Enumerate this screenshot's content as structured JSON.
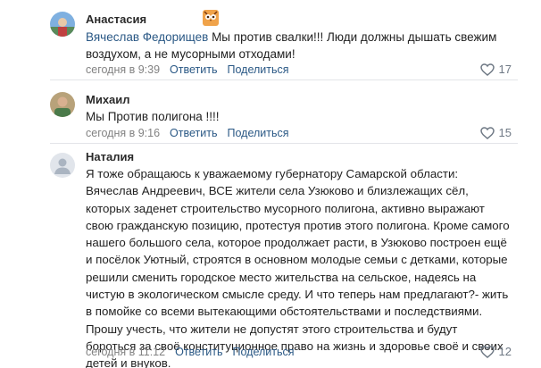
{
  "comments": [
    {
      "author": "Анастасия",
      "mention": "Вячеслав Федорищев",
      "text": " Мы против свалки!!! Люди должны дышать свежим воздухом, а не мусорными отходами!",
      "time": "сегодня в 9:39",
      "reply_label": "Ответить",
      "share_label": "Поделиться",
      "likes": "17",
      "avatar_icon": "user-photo"
    },
    {
      "author": "Михаил",
      "mention": "",
      "text": "Мы Против полигона !!!!",
      "time": "сегодня в 9:16",
      "reply_label": "Ответить",
      "share_label": "Поделиться",
      "likes": "15",
      "avatar_icon": "user-photo"
    },
    {
      "author": "Наталия",
      "mention": "",
      "text": "Я тоже обращаюсь к уважаемому губернатору Самарской области: Вячеслав Андреевич, ВСЕ жители села Узюково и близлежащих сёл, которых заденет строительство мусорного полигона, активно выражают свою гражданскую позицию, протестуя против этого полигона. Кроме самого нашего большого села, которое продолжает расти, в Узюково построен ещё и посёлок Уютный, строятся в основном молодые семьи с детками, которые решили сменить городское место жительства на сельское, надеясь на чистую в экологическом смысле среду. И что теперь нам предлагают?- жить в помойке со всеми вытекающими обстоятельствами и последствиями. Прошу учесть, что жители не допустят этого строительства и будут бороться за своё конституционное право на жизнь и здоровье своё и своих детей и внуков.",
      "time": "сегодня в 11:12",
      "reply_label": "Ответить",
      "share_label": "Поделиться",
      "likes": "12",
      "avatar_icon": "default-avatar"
    }
  ],
  "colors": {
    "link": "#2a5885",
    "meta": "#828282",
    "divider": "#e3e5e9",
    "heart": "#6f7985"
  }
}
